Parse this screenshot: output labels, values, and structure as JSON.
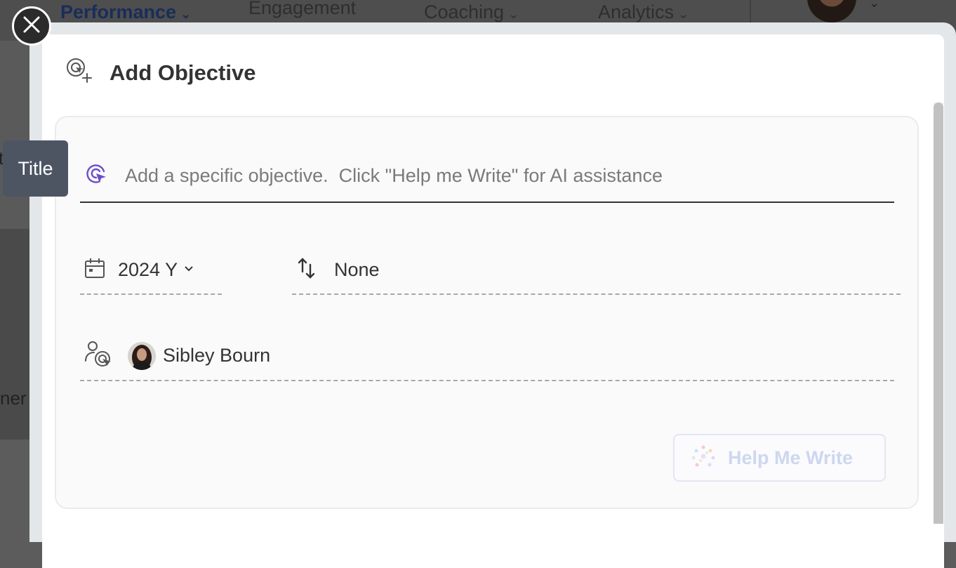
{
  "background_nav": {
    "items": [
      {
        "label": "Performance",
        "chevron": true
      },
      {
        "label": "Engagement",
        "chevron": false
      },
      {
        "label": "Coaching",
        "chevron": true
      },
      {
        "label": "Analytics",
        "chevron": true
      }
    ],
    "left_fragment_top": "t",
    "left_fragment_bottom": "ner"
  },
  "modal": {
    "title": "Add Objective",
    "icons": {
      "header": "target-add-icon",
      "close": "close-icon"
    },
    "title_field": {
      "placeholder": "Add a specific objective.  Click \"Help me Write\" for AI assistance",
      "value": "",
      "icon": "target-cursor-icon",
      "icon_color": "#6a4ec9"
    },
    "tooltip": "Title",
    "date_field": {
      "icon": "calendar-icon",
      "value": "2024 Y"
    },
    "type_field": {
      "icon": "sort-arrows-icon",
      "value": "None"
    },
    "owner_field": {
      "icon": "person-target-icon",
      "name": "Sibley Bourn"
    },
    "help_button": {
      "label": "Help Me Write",
      "icon": "sparkle-icon",
      "state": "disabled"
    }
  },
  "colors": {
    "accent": "#6a4ec9",
    "tooltip_bg": "#4d5563",
    "help_text": "#cdd7ee"
  }
}
